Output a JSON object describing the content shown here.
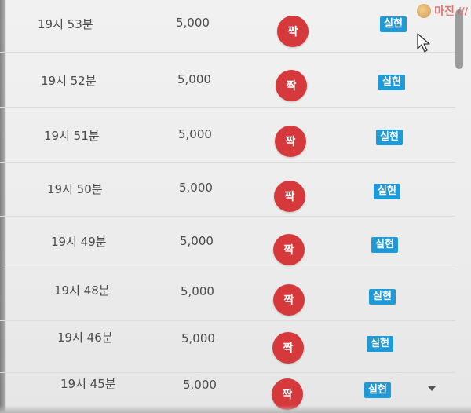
{
  "watermark": {
    "text": "마진",
    "mark": "///"
  },
  "rows": [
    {
      "time": "19시 53분",
      "amount": "5,000",
      "badge": "짝",
      "status": "실현"
    },
    {
      "time": "19시 52분",
      "amount": "5,000",
      "badge": "짝",
      "status": "실현"
    },
    {
      "time": "19시 51분",
      "amount": "5,000",
      "badge": "짝",
      "status": "실현"
    },
    {
      "time": "19시 50분",
      "amount": "5,000",
      "badge": "짝",
      "status": "실현"
    },
    {
      "time": "19시 49분",
      "amount": "5,000",
      "badge": "짝",
      "status": "실현"
    },
    {
      "time": "19시 48분",
      "amount": "5,000",
      "badge": "짝",
      "status": "실현"
    },
    {
      "time": "19시 46분",
      "amount": "5,000",
      "badge": "짝",
      "status": "실현"
    },
    {
      "time": "19시 45분",
      "amount": "5,000",
      "badge": "짝",
      "status": "실현"
    }
  ],
  "colors": {
    "badge_bg": "#d6393c",
    "tag_bg": "#1f9ad6",
    "text": "#4a4a4a"
  },
  "icons": {
    "cursor": "mouse-pointer-icon",
    "scroll_down": "chevron-down-icon",
    "watermark_logo": "coin-icon"
  }
}
